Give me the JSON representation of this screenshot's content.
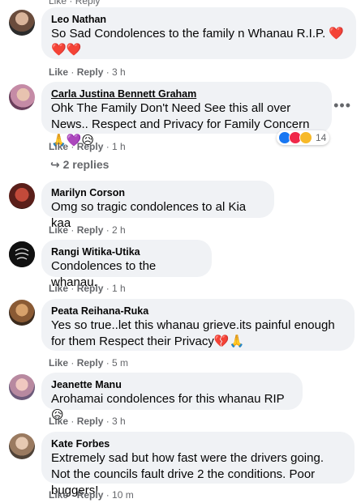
{
  "comments": [
    {
      "author": "Leo Nathan",
      "text": "So Sad Condolences to the family n Whanau R.I.P. ❤️❤️❤️",
      "like": "Like",
      "reply": "Reply",
      "time": "3 h"
    },
    {
      "author": "Carla Justina Bennett Graham",
      "text": "Ohk The Family Don't Need See this all over News.. Respect and Privacy for Family Concern 🙏💜😥",
      "like": "Like",
      "reply": "Reply",
      "time": "1 h",
      "reaction_count": "14",
      "replies_label": "2 replies"
    },
    {
      "author": "Marilyn Corson",
      "text": "Omg so tragic condolences to al Kia kaa",
      "like": "Like",
      "reply": "Reply",
      "time": "2 h"
    },
    {
      "author": "Rangi Witika-Utika",
      "text": "Condolences to the whanau.",
      "like": "Like",
      "reply": "Reply",
      "time": "1 h"
    },
    {
      "author": "Peata Reihana-Ruka",
      "text": "Yes so true..let this whanau grieve.its painful enough for them Respect their Privacy💔🙏",
      "like": "Like",
      "reply": "Reply",
      "time": "5 m"
    },
    {
      "author": "Jeanette Manu",
      "text": "Arohamai condolences for this whanau RIP 😥",
      "like": "Like",
      "reply": "Reply",
      "time": "3 h"
    },
    {
      "author": "Kate Forbes",
      "text": "Extremely sad but how fast were the drivers going. Not the councils fault drive 2 the conditions. Poor buggers!",
      "like": "Like",
      "reply": "Reply",
      "time": "10 m"
    }
  ],
  "colors": {
    "bubble": "#f0f2f5",
    "meta_text": "#65676b",
    "like_reaction": "#1877f2",
    "love_reaction": "#f02849",
    "care_reaction": "#f7b928"
  }
}
